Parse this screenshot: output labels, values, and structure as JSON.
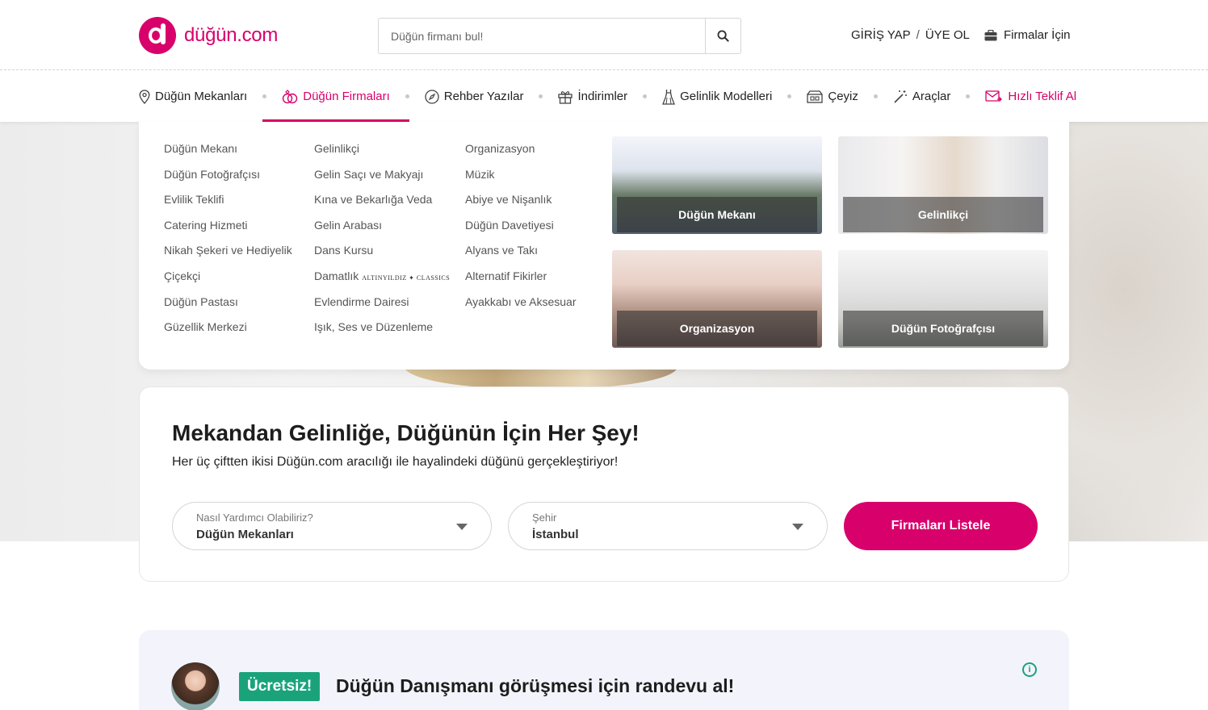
{
  "header": {
    "logo_text": "düğün.com",
    "search_placeholder": "Düğün firmanı bul!",
    "login": "GİRİŞ YAP",
    "separator": "/",
    "register": "ÜYE OL",
    "for_companies": "Firmalar İçin"
  },
  "nav": {
    "items": [
      {
        "label": "Düğün Mekanları",
        "icon": "location-pin-icon"
      },
      {
        "label": "Düğün Firmaları",
        "icon": "rings-icon",
        "active": true
      },
      {
        "label": "Rehber Yazılar",
        "icon": "compass-icon"
      },
      {
        "label": "İndirimler",
        "icon": "gift-icon"
      },
      {
        "label": "Gelinlik Modelleri",
        "icon": "dress-icon"
      },
      {
        "label": "Çeyiz",
        "icon": "box-icon"
      },
      {
        "label": "Araçlar",
        "icon": "magic-wand-icon"
      },
      {
        "label": "Hızlı Teklif Al",
        "icon": "mail-icon"
      }
    ],
    "accent_color": "#d8006b"
  },
  "dropdown": {
    "col1": [
      "Düğün Mekanı",
      "Düğün Fotoğrafçısı",
      "Evlilik Teklifi",
      "Catering Hizmeti",
      "Nikah Şekeri ve Hediyelik",
      "Çiçekçi",
      "Düğün Pastası",
      "Güzellik Merkezi"
    ],
    "col2": [
      "Gelinlikçi",
      "Gelin Saçı ve Makyajı",
      "Kına ve Bekarlığa Veda",
      "Gelin Arabası",
      "Dans Kursu",
      "Damatlık",
      "Evlendirme Dairesi",
      "Işık, Ses ve Düzenleme"
    ],
    "col2_brand": "ALTINYILDIZ ✦ CLASSICS",
    "col3": [
      "Organizasyon",
      "Müzik",
      "Abiye ve Nişanlık",
      "Düğün Davetiyesi",
      "Alyans ve Takı",
      "Alternatif Fikirler",
      "Ayakkabı ve Aksesuar"
    ],
    "tiles": [
      "Düğün Mekanı",
      "Gelinlikçi",
      "Organizasyon",
      "Düğün Fotoğrafçısı"
    ]
  },
  "search_card": {
    "title": "Mekandan Gelinliğe, Düğünün İçin Her Şey!",
    "subtitle": "Her üç çiftten ikisi Düğün.com aracılığı ile hayalindeki düğünü gerçekleştiriyor!",
    "help_label": "Nasıl Yardımcı Olabiliriz?",
    "help_value": "Düğün Mekanları",
    "city_label": "Şehir",
    "city_value": "İstanbul",
    "cta": "Firmaları Listele"
  },
  "advisor": {
    "badge": "Ücretsiz!",
    "title": "Düğün Danışmanı görüşmesi için randevu al!",
    "info_icon": "i",
    "badge_color": "#1aa37a"
  }
}
